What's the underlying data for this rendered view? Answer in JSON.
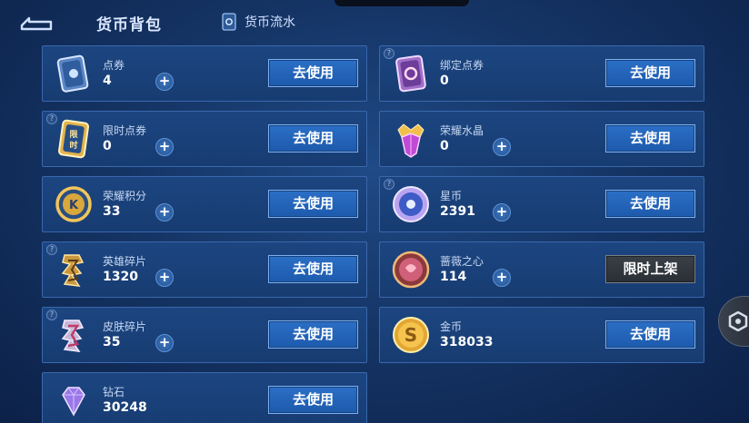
{
  "header": {
    "title": "货币背包",
    "flow_label": "货币流水"
  },
  "items": [
    {
      "name": "点券",
      "value": "4",
      "button": "去使用",
      "plus": "+",
      "icon": "ticket-icon"
    },
    {
      "name": "绑定点券",
      "value": "0",
      "button": "去使用",
      "icon": "bound-ticket-icon"
    },
    {
      "name": "限时点券",
      "value": "0",
      "button": "去使用",
      "plus": "+",
      "icon": "limited-ticket-icon"
    },
    {
      "name": "荣耀水晶",
      "value": "0",
      "button": "去使用",
      "plus": "+",
      "icon": "glory-crystal-icon"
    },
    {
      "name": "荣耀积分",
      "value": "33",
      "button": "去使用",
      "plus": "+",
      "icon": "glory-points-icon"
    },
    {
      "name": "星币",
      "value": "2391",
      "button": "去使用",
      "plus": "+",
      "icon": "star-coin-icon"
    },
    {
      "name": "英雄碎片",
      "value": "1320",
      "button": "去使用",
      "plus": "+",
      "icon": "hero-fragment-icon"
    },
    {
      "name": "蔷薇之心",
      "value": "114",
      "button": "限时上架",
      "plus": "+",
      "icon": "rose-heart-icon"
    },
    {
      "name": "皮肤碎片",
      "value": "35",
      "button": "去使用",
      "plus": "+",
      "icon": "skin-fragment-icon"
    },
    {
      "name": "金币",
      "value": "318033",
      "button": "去使用",
      "icon": "gold-coin-icon"
    },
    {
      "name": "钻石",
      "value": "30248",
      "button": "去使用",
      "icon": "diamond-icon"
    }
  ],
  "help_mark": "?",
  "colors": {
    "button_blue": "#2b6fc6",
    "button_gray": "#3a4047",
    "panel": "#1c4580"
  }
}
